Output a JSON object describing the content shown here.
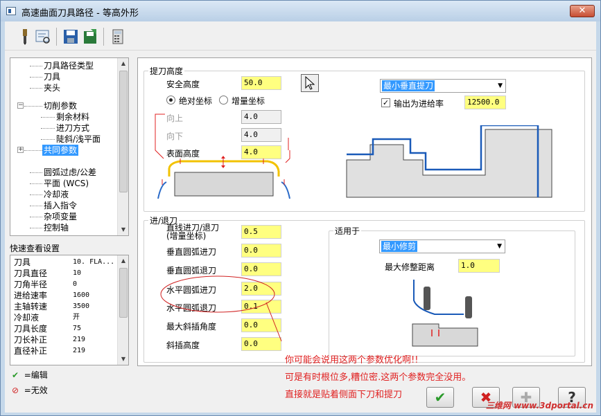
{
  "window": {
    "title": "高速曲面刀具路径 - 等高外形",
    "close_glyph": "✕"
  },
  "tree": {
    "items": [
      {
        "label": "刀具路径类型"
      },
      {
        "label": "刀具"
      },
      {
        "label": "夹头"
      },
      {
        "label": "切削参数"
      },
      {
        "label": "剩余材料"
      },
      {
        "label": "进刀方式"
      },
      {
        "label": "陡斜/浅平面"
      },
      {
        "label": "共同参数",
        "selected": true
      },
      {
        "label": "圆弧过虑/公差"
      },
      {
        "label": "平面 (WCS)"
      },
      {
        "label": "冷却液"
      },
      {
        "label": "插入指令"
      },
      {
        "label": "杂项变量"
      },
      {
        "label": "控制轴"
      }
    ]
  },
  "quick_view": {
    "title": "快速查看设置",
    "rows": [
      {
        "k": "刀具",
        "v": "10. FLA..."
      },
      {
        "k": "刀具直径",
        "v": "10"
      },
      {
        "k": "刀角半径",
        "v": "0"
      },
      {
        "k": "进给速率",
        "v": "1600"
      },
      {
        "k": "主轴转速",
        "v": "3500"
      },
      {
        "k": "冷却液",
        "v": "开"
      },
      {
        "k": "刀具长度",
        "v": "75"
      },
      {
        "k": "刀长补正",
        "v": "219"
      },
      {
        "k": "直径补正",
        "v": "219"
      }
    ]
  },
  "legend": {
    "edit": "=编辑",
    "invalid": "=无效"
  },
  "retract": {
    "title": "提刀高度",
    "safe_height_label": "安全高度",
    "safe_height_value": "50.0",
    "absolute_label": "绝对坐标",
    "incremental_label": "增量坐标",
    "up_label": "向上",
    "up_value": "4.0",
    "down_label": "向下",
    "down_value": "4.0",
    "surface_height_label": "表面高度",
    "surface_height_value": "4.0",
    "method_option": "最小垂直提刀",
    "output_as_feed_label": "输出为进给率",
    "feed_value": "12500.0"
  },
  "entry": {
    "title": "进/退刀",
    "rows": [
      {
        "label": "直线进刀/退刀\n(增量坐标)",
        "value": "0.5"
      },
      {
        "label": "垂直圆弧进刀",
        "value": "0.0"
      },
      {
        "label": "垂直圆弧退刀",
        "value": "0.0"
      },
      {
        "label": "水平圆弧进刀",
        "value": "2.0"
      },
      {
        "label": "水平圆弧退刀",
        "value": "0.1"
      },
      {
        "label": "最大斜插角度",
        "value": "0.0"
      },
      {
        "label": "斜插高度",
        "value": "0.0"
      }
    ],
    "apply_to_title": "适用于",
    "apply_option": "最小修剪",
    "max_trim_label": "最大修整距离",
    "max_trim_value": "1.0"
  },
  "notes": [
    "你可能会说用这两个参数优化啊!!",
    "可是有时根位多,糟位密.这两个参数完全没用。",
    "直接就是贴着侧面下刀和提刀"
  ],
  "buttons": {
    "ok": "✔",
    "cancel": "✖",
    "add": "✚",
    "help": "?"
  },
  "watermark": "三维网 www.3dportal.cn",
  "colors": {
    "accent": "#3399ff",
    "field": "#ffff80",
    "note": "#e02020"
  }
}
